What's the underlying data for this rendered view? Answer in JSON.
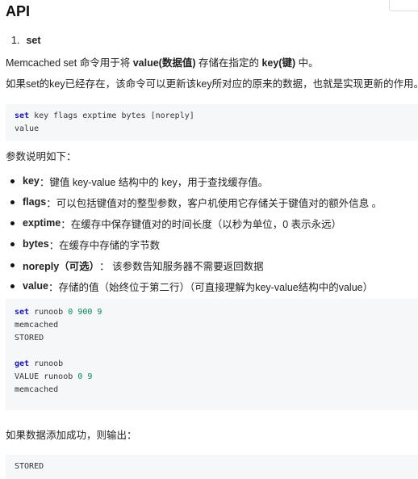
{
  "heading": "API",
  "item": {
    "number": "1.",
    "keyword": "set"
  },
  "desc": {
    "pre": "Memcached set 命令用于将 ",
    "b1": "value(数据值)",
    "mid": " 存储在指定的 ",
    "b2": "key(键)",
    "post": " 中。"
  },
  "desc2": "如果set的key已经存在，该命令可以更新该key所对应的原来的数据，也就是实现更新的作用。",
  "syntax": {
    "l1_kw": "set",
    "l1_rest": " key flags exptime bytes [noreply]",
    "l2": "value"
  },
  "params_intro": "参数说明如下：",
  "params": [
    {
      "term": "key",
      "desc": "：键值 key-value 结构中的 key，用于查找缓存值。"
    },
    {
      "term": "flags",
      "desc": "：可以包括键值对的整型参数，客户机使用它存储关于键值对的额外信息 。"
    },
    {
      "term": "exptime",
      "desc": "：在缓存中保存键值对的时间长度（以秒为单位，0 表示永远）"
    },
    {
      "term": "bytes",
      "desc": "：在缓存中存储的字节数"
    },
    {
      "term": "noreply（可选）",
      "desc": "： 该参数告知服务器不需要返回数据"
    },
    {
      "term": "value",
      "desc": "：存储的值（始终位于第二行）（可直接理解为key-value结构中的value）"
    }
  ],
  "example": {
    "l1_kw": "set",
    "l1_a": " runoob ",
    "l1_n1": "0",
    "l1_s1": " ",
    "l1_n2": "900",
    "l1_s2": " ",
    "l1_n3": "9",
    "l2": "memcached",
    "l3": "STORED",
    "l5_kw": "get",
    "l5_rest": " runoob",
    "l6_a": "VALUE runoob ",
    "l6_n1": "0",
    "l6_s": " ",
    "l6_n2": "9",
    "l7": "memcached"
  },
  "success_text": "如果数据添加成功，则输出：",
  "output": "STORED"
}
